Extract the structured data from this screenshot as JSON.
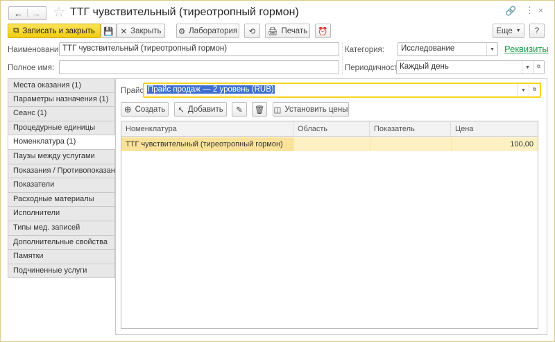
{
  "window": {
    "title": "ТТГ чувствительный (тиреотропный гормон)"
  },
  "toolbar": {
    "save_close": "Записать и закрыть",
    "close": "Закрыть",
    "lab": "Лаборатория",
    "print": "Печать",
    "more": "Еще",
    "help": "?"
  },
  "form": {
    "name_label": "Наименование:",
    "name_value": "ТТГ чувствительный (тиреотропный гормон)",
    "fullname_label": "Полное имя:",
    "fullname_value": "",
    "category_label": "Категория:",
    "category_value": "Исследование",
    "requisites_link": "Реквизиты",
    "period_label": "Периодичность:",
    "period_value": "Каждый день"
  },
  "tabs": [
    {
      "label": "Места оказания (1)"
    },
    {
      "label": "Параметры назначения (1)"
    },
    {
      "label": "Сеанс (1)"
    },
    {
      "label": "Процедурные единицы"
    },
    {
      "label": "Номенклатура (1)",
      "selected": true
    },
    {
      "label": "Паузы между услугами"
    },
    {
      "label": "Показания / Противопоказания"
    },
    {
      "label": "Показатели"
    },
    {
      "label": "Расходные материалы"
    },
    {
      "label": "Исполнители"
    },
    {
      "label": "Типы мед. записей"
    },
    {
      "label": "Дополнительные свойства"
    },
    {
      "label": "Памятки"
    },
    {
      "label": "Подчиненные услуги"
    }
  ],
  "price": {
    "label": "Прайс:",
    "value": "Прайс продаж — 2 уровень (RUB)"
  },
  "table_toolbar": {
    "create": "Создать",
    "add": "Добавить",
    "set_prices": "Установить цены"
  },
  "table": {
    "columns": [
      "Номенклатура",
      "Область",
      "Показатель",
      "Цена"
    ],
    "rows": [
      [
        "ТТГ чувствительный (тиреотропный гормон)",
        "",
        "",
        "100,00"
      ]
    ]
  },
  "colors": {
    "accent_yellow": "#f5d51d",
    "selected_row": "#fbe29a",
    "link_green": "#1e9e4a"
  }
}
